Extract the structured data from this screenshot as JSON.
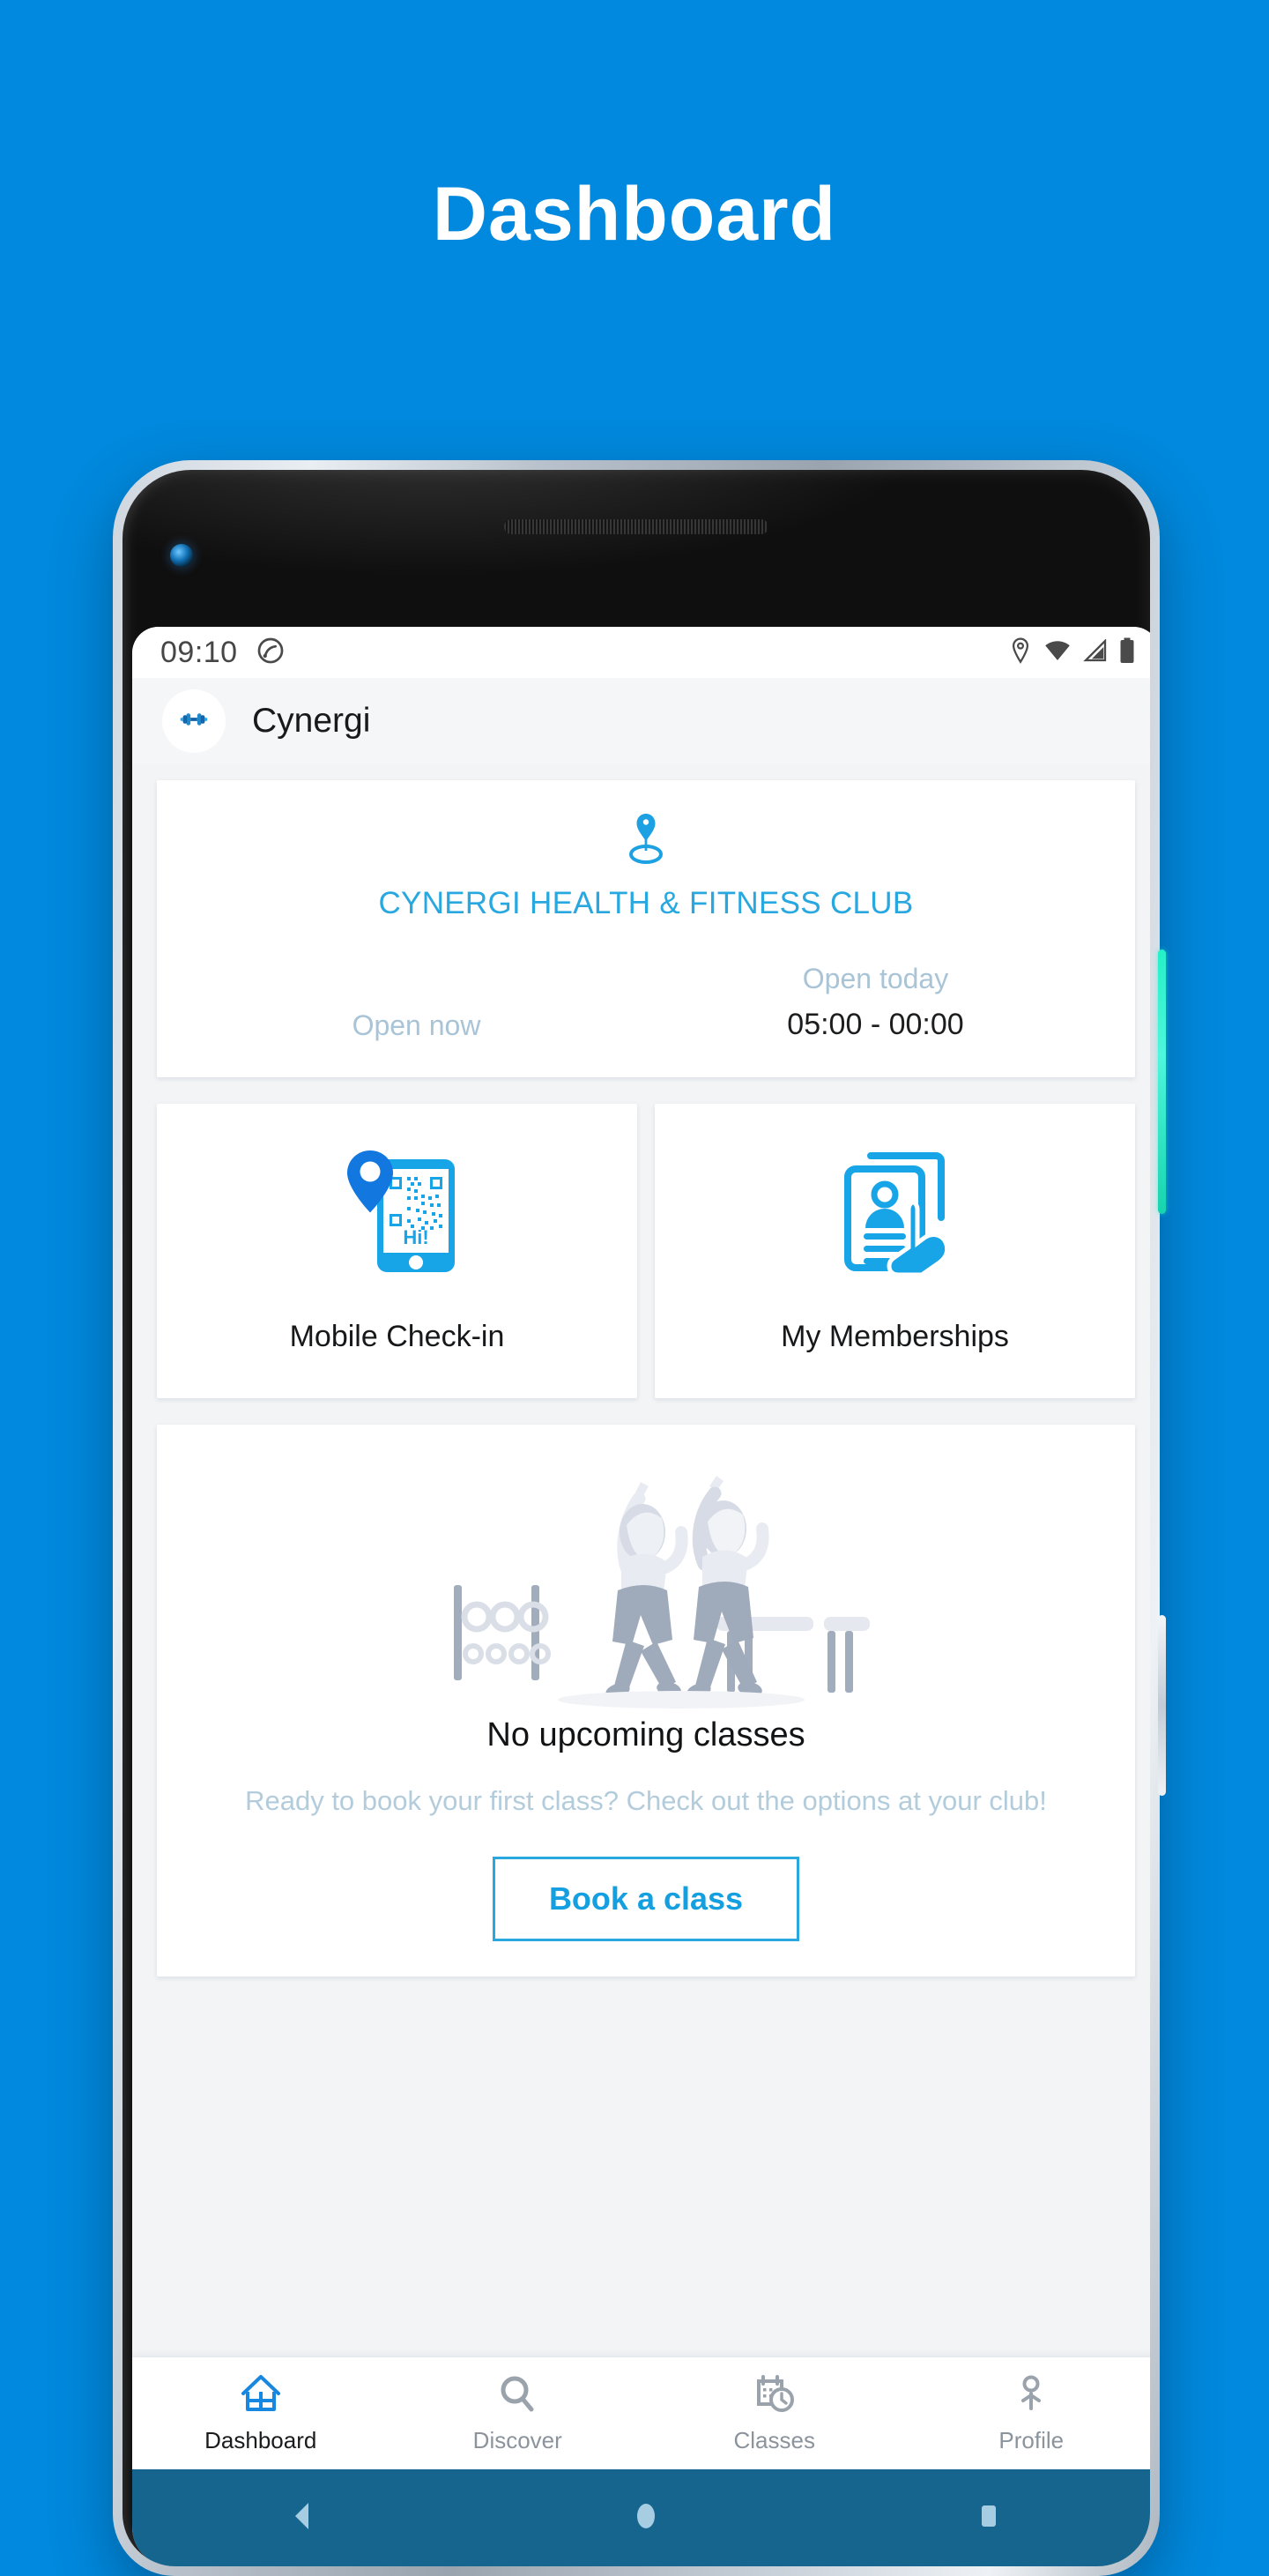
{
  "promo": {
    "title": "Dashboard",
    "background_color": "#0089de"
  },
  "phone": {
    "hardware": {
      "power_button": "power-button",
      "volume_button": "volume-rocker",
      "camera": "front-camera",
      "speaker": "earpiece-speaker"
    }
  },
  "status_bar": {
    "time": "09:10",
    "left_icons": [
      "do-not-disturb-icon"
    ],
    "right_icons": [
      "location-icon",
      "wifi-icon",
      "cellular-signal-icon",
      "battery-icon"
    ]
  },
  "app_bar": {
    "logo_icon": "dumbbell-icon",
    "app_name": "Cynergi"
  },
  "club_card": {
    "pin_icon": "location-pin-icon",
    "club_name": "CYNERGI HEALTH & FITNESS CLUB",
    "open_now_label": "Open now",
    "open_today_label": "Open today",
    "open_today_hours": "05:00 - 00:00",
    "accent_color": "#29a8e0",
    "muted_color": "#a9c4d6"
  },
  "tiles": [
    {
      "icon": "mobile-checkin-icon",
      "label": "Mobile Check-in"
    },
    {
      "icon": "membership-card-icon",
      "label": "My Memberships"
    }
  ],
  "classes_card": {
    "illustration": "two-people-exercising-illustration",
    "empty_title": "No upcoming classes",
    "empty_subtitle": "Ready to book your first class? Check out the options at your club!",
    "cta_label": "Book a class"
  },
  "bottom_nav": {
    "active_index": 0,
    "items": [
      {
        "icon": "home-icon",
        "label": "Dashboard"
      },
      {
        "icon": "search-icon",
        "label": "Discover"
      },
      {
        "icon": "calendar-clock-icon",
        "label": "Classes"
      },
      {
        "icon": "person-icon",
        "label": "Profile"
      }
    ],
    "active_color": "#1887e0",
    "inactive_color": "#9aa3ab"
  },
  "system_nav": {
    "background_color": "#16658f",
    "buttons": [
      "back-button",
      "home-button",
      "recents-button"
    ]
  }
}
